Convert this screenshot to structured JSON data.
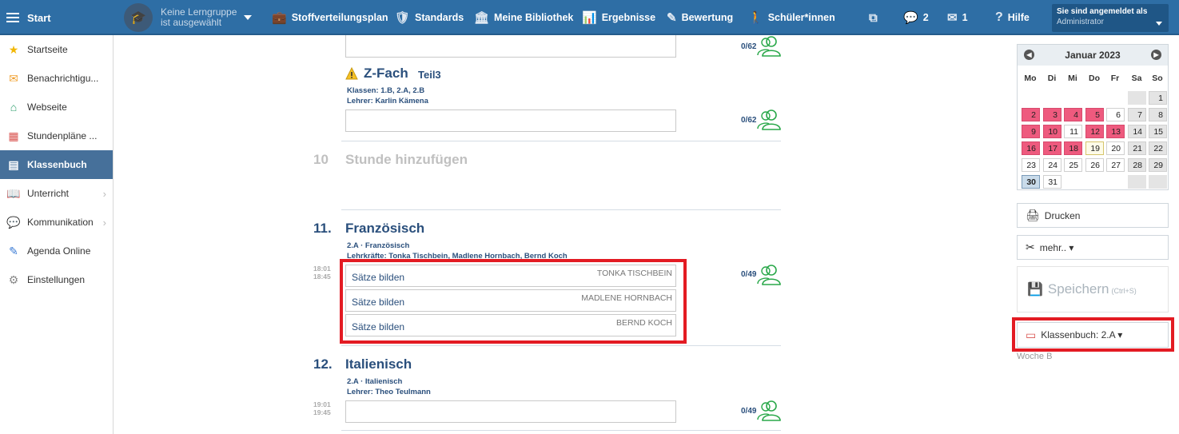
{
  "topbar": {
    "start_label": "Start",
    "group_selector": "Keine Lerngruppe ist ausgewählt",
    "nav": [
      {
        "label": "Stoffverteilungsplan",
        "icon": "briefcase-icon",
        "glyph": "💼"
      },
      {
        "label": "Standards",
        "icon": "shield-icon",
        "glyph": "🛡"
      },
      {
        "label": "Meine Bibliothek",
        "icon": "library-icon",
        "glyph": "🏛"
      },
      {
        "label": "Ergebnisse",
        "icon": "bar-chart-icon",
        "glyph": "📊"
      },
      {
        "label": "Bewertung",
        "icon": "grading-icon",
        "glyph": "✎"
      },
      {
        "label": "Schüler*innen",
        "icon": "students-icon",
        "glyph": "🚶"
      }
    ],
    "messages_count": "2",
    "mail_count": "1",
    "help_label": "Hilfe",
    "login_line1": "Sie sind angemeldet als",
    "login_line2": "Administrator"
  },
  "sidebar": {
    "items": [
      {
        "label": "Startseite",
        "icon": "star-icon",
        "glyph": "★",
        "color": "#f2b705"
      },
      {
        "label": "Benachrichtigu...",
        "icon": "envelope-icon",
        "glyph": "✉",
        "color": "#f0a030"
      },
      {
        "label": "Webseite",
        "icon": "home-icon",
        "glyph": "⌂",
        "color": "#2a9d6a"
      },
      {
        "label": "Stundenpläne ...",
        "icon": "timetable-icon",
        "glyph": "▦",
        "color": "#d9534f"
      },
      {
        "label": "Klassenbuch",
        "icon": "classbook-icon",
        "glyph": "▤",
        "color": "#ffffff",
        "active": true
      },
      {
        "label": "Unterricht",
        "icon": "book-open-icon",
        "glyph": "📖",
        "color": "#2e6ea5",
        "chevron": true
      },
      {
        "label": "Kommunikation",
        "icon": "chat-icon",
        "glyph": "💬",
        "color": "#c0392b",
        "chevron": true
      },
      {
        "label": "Agenda Online",
        "icon": "pen-icon",
        "glyph": "✎",
        "color": "#3a7bd5"
      },
      {
        "label": "Einstellungen",
        "icon": "gear-icon",
        "glyph": "⚙",
        "color": "#888888"
      }
    ]
  },
  "main": {
    "top_count": "0/62",
    "zfach": {
      "title": "Z-Fach",
      "part": "Teil3",
      "classes": "Klassen:  1.B, 2.A, 2.B",
      "teacher": "Lehrer:   Karlin Kämena",
      "count": "0/62"
    },
    "add_lesson": {
      "num": "10",
      "label": "Stunde hinzufügen"
    },
    "french": {
      "num": "11.",
      "title": "Französisch",
      "class_line": "2.A · Französisch",
      "teachers_line": "Lehrkräfte:   Tonka Tischbein, Madlene Hornbach, Bernd Koch",
      "time_start": "18:01",
      "time_end": "18:45",
      "count": "0/49",
      "rows": [
        {
          "topic": "Sätze bilden",
          "teacher": "TONKA TISCHBEIN"
        },
        {
          "topic": "Sätze bilden",
          "teacher": "MADLENE HORNBACH"
        },
        {
          "topic": "Sätze bilden",
          "teacher": "BERND KOCH"
        }
      ]
    },
    "italian": {
      "num": "12.",
      "title": "Italienisch",
      "class_line": "2.A · Italienisch",
      "teacher_line": "Lehrer:   Theo Teulmann",
      "time_start": "19:01",
      "time_end": "19:45",
      "count": "0/49"
    }
  },
  "right": {
    "calendar": {
      "month": "Januar 2023",
      "weekdays": [
        "Mo",
        "Di",
        "Mi",
        "Do",
        "Fr",
        "Sa",
        "So"
      ],
      "weeks": [
        [
          null,
          null,
          null,
          null,
          null,
          null,
          1
        ],
        [
          2,
          3,
          4,
          5,
          6,
          7,
          8
        ],
        [
          9,
          10,
          11,
          12,
          13,
          14,
          15
        ],
        [
          16,
          17,
          18,
          19,
          20,
          21,
          22
        ],
        [
          23,
          24,
          25,
          26,
          27,
          28,
          29
        ],
        [
          30,
          31,
          null,
          null,
          null,
          null,
          null
        ]
      ],
      "highlighted_days": [
        2,
        3,
        4,
        5,
        9,
        10,
        12,
        13,
        16,
        17,
        18
      ],
      "today": 19,
      "selected": 30
    },
    "print_label": "Drucken",
    "more_label": "mehr.. ▾",
    "save_label": "Speichern",
    "save_shortcut": "(Ctrl+S)",
    "classbook_label": "Klassenbuch: 2.A ▾",
    "week_label": "Woche B"
  },
  "colors": {
    "accent": "#2e6ea5",
    "highlight_red": "#e31b23",
    "calendar_red": "#ee5a7e",
    "green": "#2aa84a"
  }
}
